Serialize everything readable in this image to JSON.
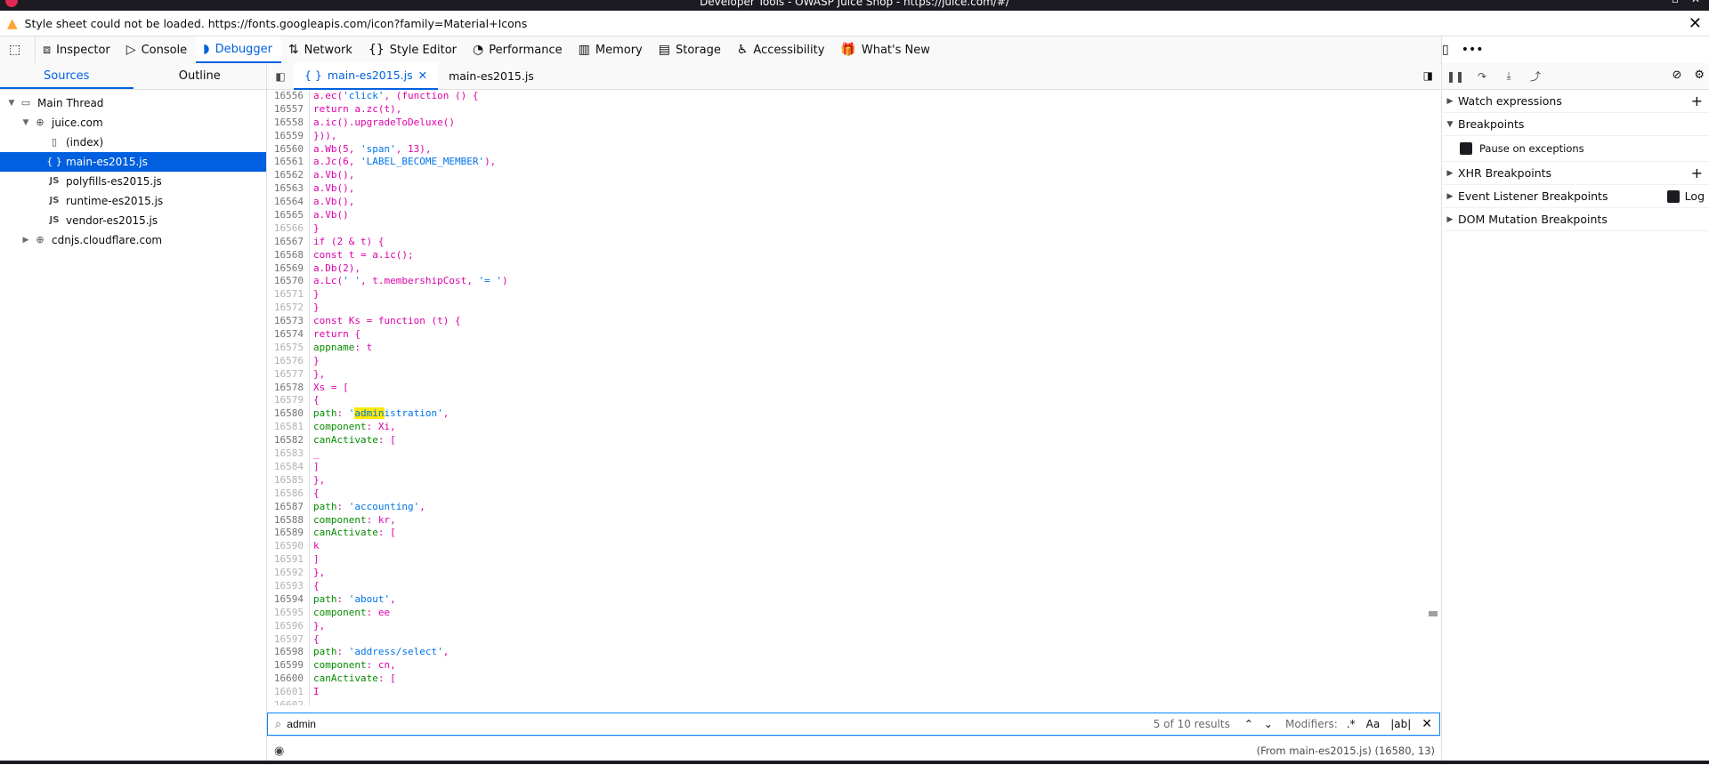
{
  "window": {
    "title": "Developer Tools - OWASP Juice Shop - https://juice.com/#/"
  },
  "warning": {
    "text": "Style sheet could not be loaded. https://fonts.googleapis.com/icon?family=Material+Icons"
  },
  "toolbar": {
    "tools": [
      {
        "name": "inspector",
        "label": "Inspector",
        "icon": "inspector-icon",
        "glyph": "⧈"
      },
      {
        "name": "console",
        "label": "Console",
        "icon": "console-icon",
        "glyph": "▷"
      },
      {
        "name": "debugger",
        "label": "Debugger",
        "icon": "debugger-icon",
        "glyph": "◗",
        "active": true
      },
      {
        "name": "network",
        "label": "Network",
        "icon": "network-icon",
        "glyph": "⇅"
      },
      {
        "name": "style-editor",
        "label": "Style Editor",
        "icon": "braces-icon",
        "glyph": "{}"
      },
      {
        "name": "performance",
        "label": "Performance",
        "icon": "gauge-icon",
        "glyph": "◔"
      },
      {
        "name": "memory",
        "label": "Memory",
        "icon": "memory-icon",
        "glyph": "▥"
      },
      {
        "name": "storage",
        "label": "Storage",
        "icon": "storage-icon",
        "glyph": "▤"
      },
      {
        "name": "accessibility",
        "label": "Accessibility",
        "icon": "accessibility-icon",
        "glyph": "♿"
      },
      {
        "name": "whats-new",
        "label": "What's New",
        "icon": "gift-icon",
        "glyph": "🎁"
      }
    ]
  },
  "sources_panel": {
    "tabs": [
      "Sources",
      "Outline"
    ],
    "tree": [
      {
        "label": "Main Thread",
        "icon": "window-icon",
        "glyph": "▭",
        "depth": 0,
        "twisty": "▼"
      },
      {
        "label": "juice.com",
        "icon": "globe-icon",
        "glyph": "⊕",
        "depth": 1,
        "twisty": "▼"
      },
      {
        "label": "(index)",
        "icon": "file-icon",
        "glyph": "▯",
        "depth": 2,
        "twisty": ""
      },
      {
        "label": "main-es2015.js",
        "icon": "pretty-print-icon",
        "glyph": "{ }",
        "depth": 2,
        "twisty": "",
        "selected": true
      },
      {
        "label": "polyfills-es2015.js",
        "icon": "js-file-icon",
        "glyph": "JS",
        "depth": 2,
        "twisty": ""
      },
      {
        "label": "runtime-es2015.js",
        "icon": "js-file-icon",
        "glyph": "JS",
        "depth": 2,
        "twisty": ""
      },
      {
        "label": "vendor-es2015.js",
        "icon": "js-file-icon",
        "glyph": "JS",
        "depth": 2,
        "twisty": ""
      },
      {
        "label": "cdnjs.cloudflare.com",
        "icon": "globe-icon",
        "glyph": "⊕",
        "depth": 1,
        "twisty": "▶"
      }
    ]
  },
  "editor": {
    "tabs": [
      {
        "label": "main-es2015.js",
        "active": true,
        "prefix": "{ }"
      },
      {
        "label": "main-es2015.js",
        "active": false,
        "prefix": ""
      }
    ],
    "lines": [
      {
        "n": "16556",
        "t": "a.ec('click', (function () {"
      },
      {
        "n": "16557",
        "t": "return a.zc(t),"
      },
      {
        "n": "16558",
        "t": "a.ic().upgradeToDeluxe()"
      },
      {
        "n": "16559",
        "t": "})),"
      },
      {
        "n": "16560",
        "t": "a.Wb(5, 'span', 13),"
      },
      {
        "n": "16561",
        "t": "a.Jc(6, 'LABEL_BECOME_MEMBER'),"
      },
      {
        "n": "16562",
        "t": "a.Vb(),"
      },
      {
        "n": "16563",
        "t": "a.Vb(),"
      },
      {
        "n": "16564",
        "t": "a.Vb(),"
      },
      {
        "n": "16565",
        "t": "a.Vb()"
      },
      {
        "n": "16566",
        "t": "}",
        "dim": true
      },
      {
        "n": "16567",
        "t": "if (2 & t) {"
      },
      {
        "n": "16568",
        "t": "const t = a.ic();"
      },
      {
        "n": "16569",
        "t": "a.Db(2),"
      },
      {
        "n": "16570",
        "t": "a.Lc(' ', t.membershipCost, '= ')"
      },
      {
        "n": "16571",
        "t": "}",
        "dim": true
      },
      {
        "n": "16572",
        "t": "}",
        "dim": true
      },
      {
        "n": "16573",
        "t": "const Ks = function (t) {"
      },
      {
        "n": "16574",
        "t": "return {"
      },
      {
        "n": "16575",
        "t": "appname: t",
        "dim": true
      },
      {
        "n": "16576",
        "t": "}",
        "dim": true
      },
      {
        "n": "16577",
        "t": "},",
        "dim": true
      },
      {
        "n": "16578",
        "t": "Xs = ["
      },
      {
        "n": "16579",
        "t": "{",
        "dim": true
      },
      {
        "n": "16580",
        "t": "path: 'administration',",
        "hl": "admin"
      },
      {
        "n": "16581",
        "t": "component: Xi,",
        "dim": true
      },
      {
        "n": "16582",
        "t": "canActivate: ["
      },
      {
        "n": "16583",
        "t": "_",
        "dim": true
      },
      {
        "n": "16584",
        "t": "]",
        "dim": true
      },
      {
        "n": "16585",
        "t": "},",
        "dim": true
      },
      {
        "n": "16586",
        "t": "{",
        "dim": true
      },
      {
        "n": "16587",
        "t": "path: 'accounting',"
      },
      {
        "n": "16588",
        "t": "component: kr,"
      },
      {
        "n": "16589",
        "t": "canActivate: ["
      },
      {
        "n": "16590",
        "t": "k",
        "dim": true
      },
      {
        "n": "16591",
        "t": "]",
        "dim": true
      },
      {
        "n": "16592",
        "t": "},",
        "dim": true
      },
      {
        "n": "16593",
        "t": "{",
        "dim": true
      },
      {
        "n": "16594",
        "t": "path: 'about',"
      },
      {
        "n": "16595",
        "t": "component: ee",
        "dim": true
      },
      {
        "n": "16596",
        "t": "},",
        "dim": true
      },
      {
        "n": "16597",
        "t": "{",
        "dim": true
      },
      {
        "n": "16598",
        "t": "path: 'address/select',"
      },
      {
        "n": "16599",
        "t": "component: cn,"
      },
      {
        "n": "16600",
        "t": "canActivate: ["
      },
      {
        "n": "16601",
        "t": "I",
        "dim": true
      },
      {
        "n": "16602",
        "t": "",
        "dim": true
      }
    ]
  },
  "search": {
    "query": "admin",
    "results": "5 of 10 results",
    "modifiers_label": "Modifiers:",
    "regex": ".*",
    "case": "Aa",
    "whole": "|ab|"
  },
  "status": {
    "location": "(From main-es2015.js)   (16580, 13)"
  },
  "breakpoints_panel": {
    "sections": [
      {
        "label": "Watch expressions",
        "open": false,
        "plus": true
      },
      {
        "label": "Breakpoints",
        "open": true,
        "plus": false
      },
      {
        "label": "XHR Breakpoints",
        "open": false,
        "plus": true
      },
      {
        "label": "Event Listener Breakpoints",
        "open": false,
        "plus": false,
        "log": "Log"
      },
      {
        "label": "DOM Mutation Breakpoints",
        "open": false,
        "plus": false
      }
    ],
    "pause_on_exceptions": "Pause on exceptions"
  },
  "colors": {
    "accent": "#0061e0",
    "selected_bg": "#0060df",
    "keyword": "#dd00a9",
    "string": "#0074e8",
    "property": "#058b00",
    "highlight": "#ffe900"
  }
}
